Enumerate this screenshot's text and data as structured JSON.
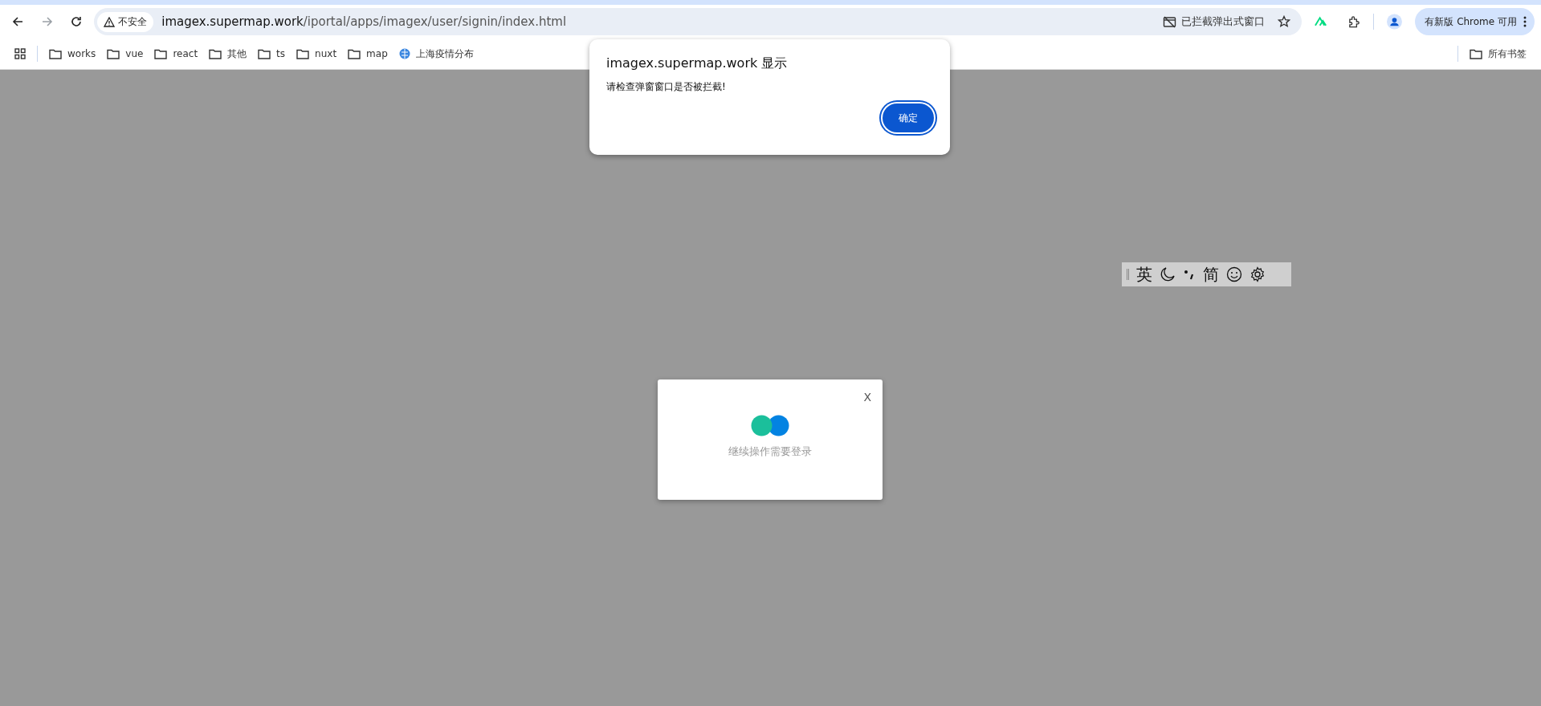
{
  "browser": {
    "nav_buttons": [
      {
        "kind": "back",
        "disabled": false
      },
      {
        "kind": "forward",
        "disabled": true
      },
      {
        "kind": "reload",
        "disabled": false
      }
    ],
    "security_label": "不安全",
    "url": {
      "host": "imagex.supermap.work",
      "path": "/iportal/apps/imagex/user/signin/index.html"
    },
    "popup_blocked": "已拦截弹出式窗口",
    "update_button": "有新版 Chrome 可用",
    "bookmarks": [
      {
        "kind": "folder",
        "label": "works"
      },
      {
        "kind": "folder",
        "label": "vue"
      },
      {
        "kind": "folder",
        "label": "react"
      },
      {
        "kind": "folder",
        "label": "其他"
      },
      {
        "kind": "folder",
        "label": "ts"
      },
      {
        "kind": "folder",
        "label": "nuxt"
      },
      {
        "kind": "folder",
        "label": "map"
      },
      {
        "kind": "site",
        "label": "上海疫情分布"
      }
    ],
    "all_bookmarks": "所有书签"
  },
  "alert": {
    "title": "imagex.supermap.work 显示",
    "message": "请检查弹窗窗口是否被拦截!",
    "button": "确定"
  },
  "ime_toolbar": {
    "mode_label": "英",
    "charset_label": "简"
  },
  "login_modal": {
    "close": "X",
    "message": "继续操作需要登录"
  }
}
